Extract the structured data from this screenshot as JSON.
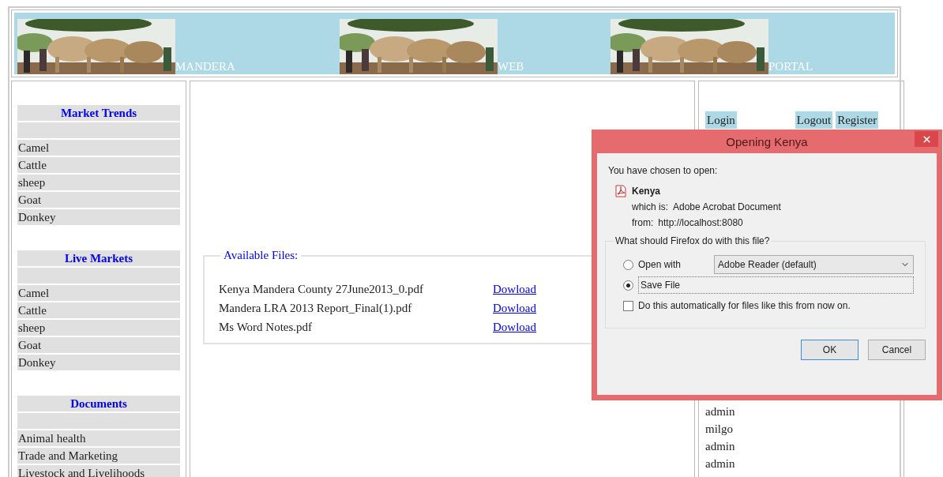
{
  "header": {
    "segments": [
      {
        "label": "MANDERA"
      },
      {
        "label": "WEB"
      },
      {
        "label": "PORTAL"
      }
    ]
  },
  "sidebar": {
    "sections": [
      {
        "title": "Market Trends",
        "items": [
          "Camel",
          "Cattle",
          "sheep",
          "Goat",
          "Donkey"
        ]
      },
      {
        "title": "Live Markets",
        "items": [
          "Camel",
          "Cattle",
          "sheep",
          "Goat",
          "Donkey"
        ]
      },
      {
        "title": "Documents",
        "items": [
          "Animal health",
          "Trade and Marketing",
          "Livestock and Livelihoods"
        ]
      }
    ]
  },
  "files": {
    "legend": "Available Files:",
    "rows": [
      {
        "name": "Kenya Mandera County 27June2013_0.pdf",
        "link": "Dowload"
      },
      {
        "name": "Mandera LRA 2013 Report_Final(1).pdf",
        "link": "Dowload"
      },
      {
        "name": "Ms Word Notes.pdf",
        "link": "Dowload"
      }
    ]
  },
  "account": {
    "links": [
      "Login",
      "Logout",
      "Register"
    ],
    "users": [
      "admin",
      "milgo",
      "admin",
      "admin"
    ]
  },
  "dialog": {
    "title": "Opening Kenya",
    "intro": "You have chosen to open:",
    "file_name": "Kenya",
    "type_label": "which is:",
    "type_value": "Adobe Acrobat Document",
    "from_label": "from:",
    "from_value": "http://localhost:8080",
    "group_legend": "What should Firefox do with this file?",
    "options": [
      {
        "label": "Open with",
        "selected": false
      },
      {
        "label": "Save File",
        "selected": true
      }
    ],
    "app_select": "Adobe Reader  (default)",
    "auto": {
      "label": "Do this automatically for files like this from now on.",
      "checked": false
    },
    "buttons": [
      {
        "label": "OK",
        "default": true
      },
      {
        "label": "Cancel",
        "default": false
      }
    ]
  }
}
